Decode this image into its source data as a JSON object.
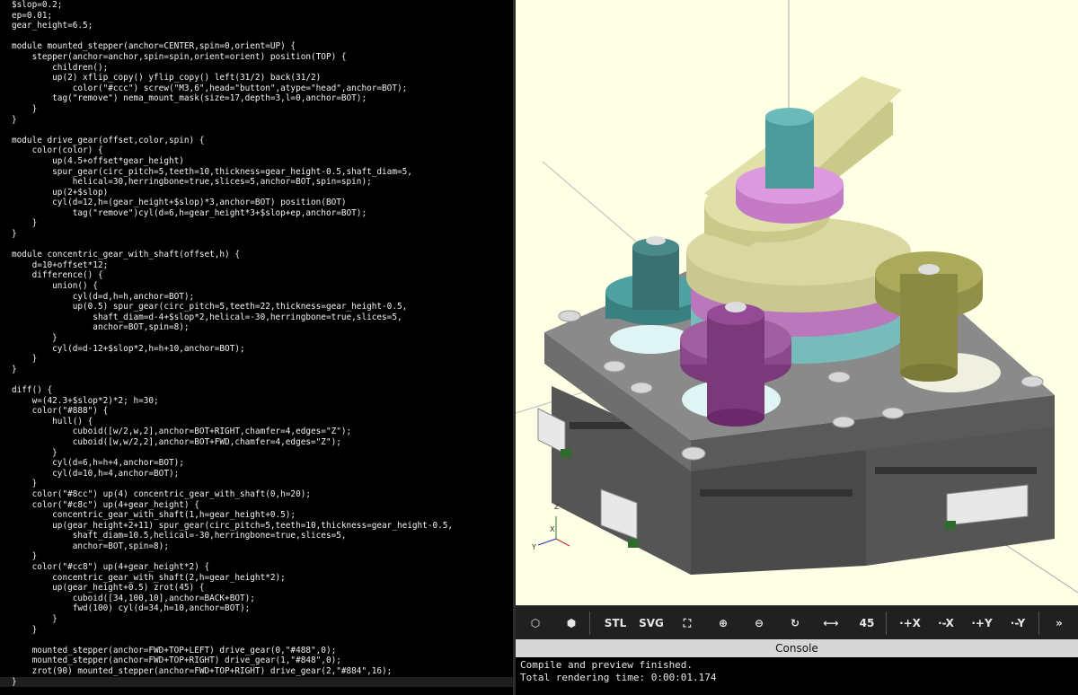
{
  "editor": {
    "lines": [
      "$slop=0.2;",
      "ep=0.01;",
      "gear_height=6.5;",
      "",
      "module mounted_stepper(anchor=CENTER,spin=0,orient=UP) {",
      "    stepper(anchor=anchor,spin=spin,orient=orient) position(TOP) {",
      "        children();",
      "        up(2) xflip_copy() yflip_copy() left(31/2) back(31/2)",
      "            color(\"#ccc\") screw(\"M3,6\",head=\"button\",atype=\"head\",anchor=BOT);",
      "        tag(\"remove\") nema_mount_mask(size=17,depth=3,l=0,anchor=BOT);",
      "    }",
      "}",
      "",
      "module drive_gear(offset,color,spin) {",
      "    color(color) {",
      "        up(4.5+offset*gear_height)",
      "        spur_gear(circ_pitch=5,teeth=10,thickness=gear_height-0.5,shaft_diam=5,",
      "            helical=30,herringbone=true,slices=5,anchor=BOT,spin=spin);",
      "        up(2+$slop)",
      "        cyl(d=12,h=(gear_height+$slop)*3,anchor=BOT) position(BOT)",
      "            tag(\"remove\")cyl(d=6,h=gear_height*3+$slop+ep,anchor=BOT);",
      "    }",
      "}",
      "",
      "module concentric_gear_with_shaft(offset,h) {",
      "    d=10+offset*12;",
      "    difference() {",
      "        union() {",
      "            cyl(d=d,h=h,anchor=BOT);",
      "            up(0.5) spur_gear(circ_pitch=5,teeth=22,thickness=gear_height-0.5,",
      "                shaft_diam=d-4+$slop*2,helical=-30,herringbone=true,slices=5,",
      "                anchor=BOT,spin=8);",
      "        }",
      "        cyl(d=d-12+$slop*2,h=h+10,anchor=BOT);",
      "    }",
      "}",
      "",
      "diff() {",
      "    w=(42.3+$slop*2)*2; h=30;",
      "    color(\"#888\") {",
      "        hull() {",
      "            cuboid([w/2,w,2],anchor=BOT+RIGHT,chamfer=4,edges=\"Z\");",
      "            cuboid([w,w/2,2],anchor=BOT+FWD,chamfer=4,edges=\"Z\");",
      "        }",
      "        cyl(d=6,h=h+4,anchor=BOT);",
      "        cyl(d=10,h=4,anchor=BOT);",
      "    }",
      "    color(\"#8cc\") up(4) concentric_gear_with_shaft(0,h=20);",
      "    color(\"#c8c\") up(4+gear_height) {",
      "        concentric_gear_with_shaft(1,h=gear_height+0.5);",
      "        up(gear_height+2+11) spur_gear(circ_pitch=5,teeth=10,thickness=gear_height-0.5,",
      "            shaft_diam=10.5,helical=-30,herringbone=true,slices=5,",
      "            anchor=BOT,spin=8);",
      "    }",
      "    color(\"#cc8\") up(4+gear_height*2) {",
      "        concentric_gear_with_shaft(2,h=gear_height*2);",
      "        up(gear_height+0.5) zrot(45) {",
      "            cuboid([34,100,10],anchor=BACK+BOT);",
      "            fwd(100) cyl(d=34,h=10,anchor=BOT);",
      "        }",
      "    }",
      "",
      "    mounted_stepper(anchor=FWD+TOP+LEFT) drive_gear(0,\"#488\",0);",
      "    mounted_stepper(anchor=FWD+TOP+RIGHT) drive_gear(1,\"#848\",0);",
      "    zrot(90) mounted_stepper(anchor=FWD+TOP+RIGHT) drive_gear(2,\"#884\",16);",
      "}"
    ]
  },
  "viewport": {
    "axis_labels": {
      "z": "Z",
      "x": "X",
      "y": "Y"
    },
    "colors": {
      "background": "#ffffe6",
      "base": "#888888",
      "teal_gear": "#448888",
      "purple_gear": "#884488",
      "olive_gear": "#888844",
      "cyan_gear": "#88cccc",
      "pink_gear": "#cc88cc",
      "yellow_arm": "#cccc88"
    }
  },
  "toolbar": {
    "buttons": [
      {
        "name": "preview-icon",
        "glyph": "⬡"
      },
      {
        "name": "render-icon",
        "glyph": "⬢"
      },
      {
        "name": "export-stl",
        "glyph": "STL"
      },
      {
        "name": "export-svg",
        "glyph": "SVG"
      },
      {
        "name": "view-all-icon",
        "glyph": "⛶"
      },
      {
        "name": "zoom-in-icon",
        "glyph": "⊕"
      },
      {
        "name": "zoom-out-icon",
        "glyph": "⊖"
      },
      {
        "name": "reset-view-icon",
        "glyph": "↻"
      },
      {
        "name": "perspective-icon",
        "glyph": "⟷"
      },
      {
        "name": "orthogonal-icon",
        "glyph": "45"
      },
      {
        "name": "view-plus-x",
        "glyph": "·+X"
      },
      {
        "name": "view-minus-x",
        "glyph": "·-X"
      },
      {
        "name": "view-plus-y",
        "glyph": "·+Y"
      },
      {
        "name": "view-minus-y",
        "glyph": "·-Y"
      },
      {
        "name": "more-icon",
        "glyph": "»"
      }
    ]
  },
  "console": {
    "title": "Console",
    "lines": [
      "Compile and preview finished.",
      "Total rendering time: 0:00:01.174"
    ]
  }
}
